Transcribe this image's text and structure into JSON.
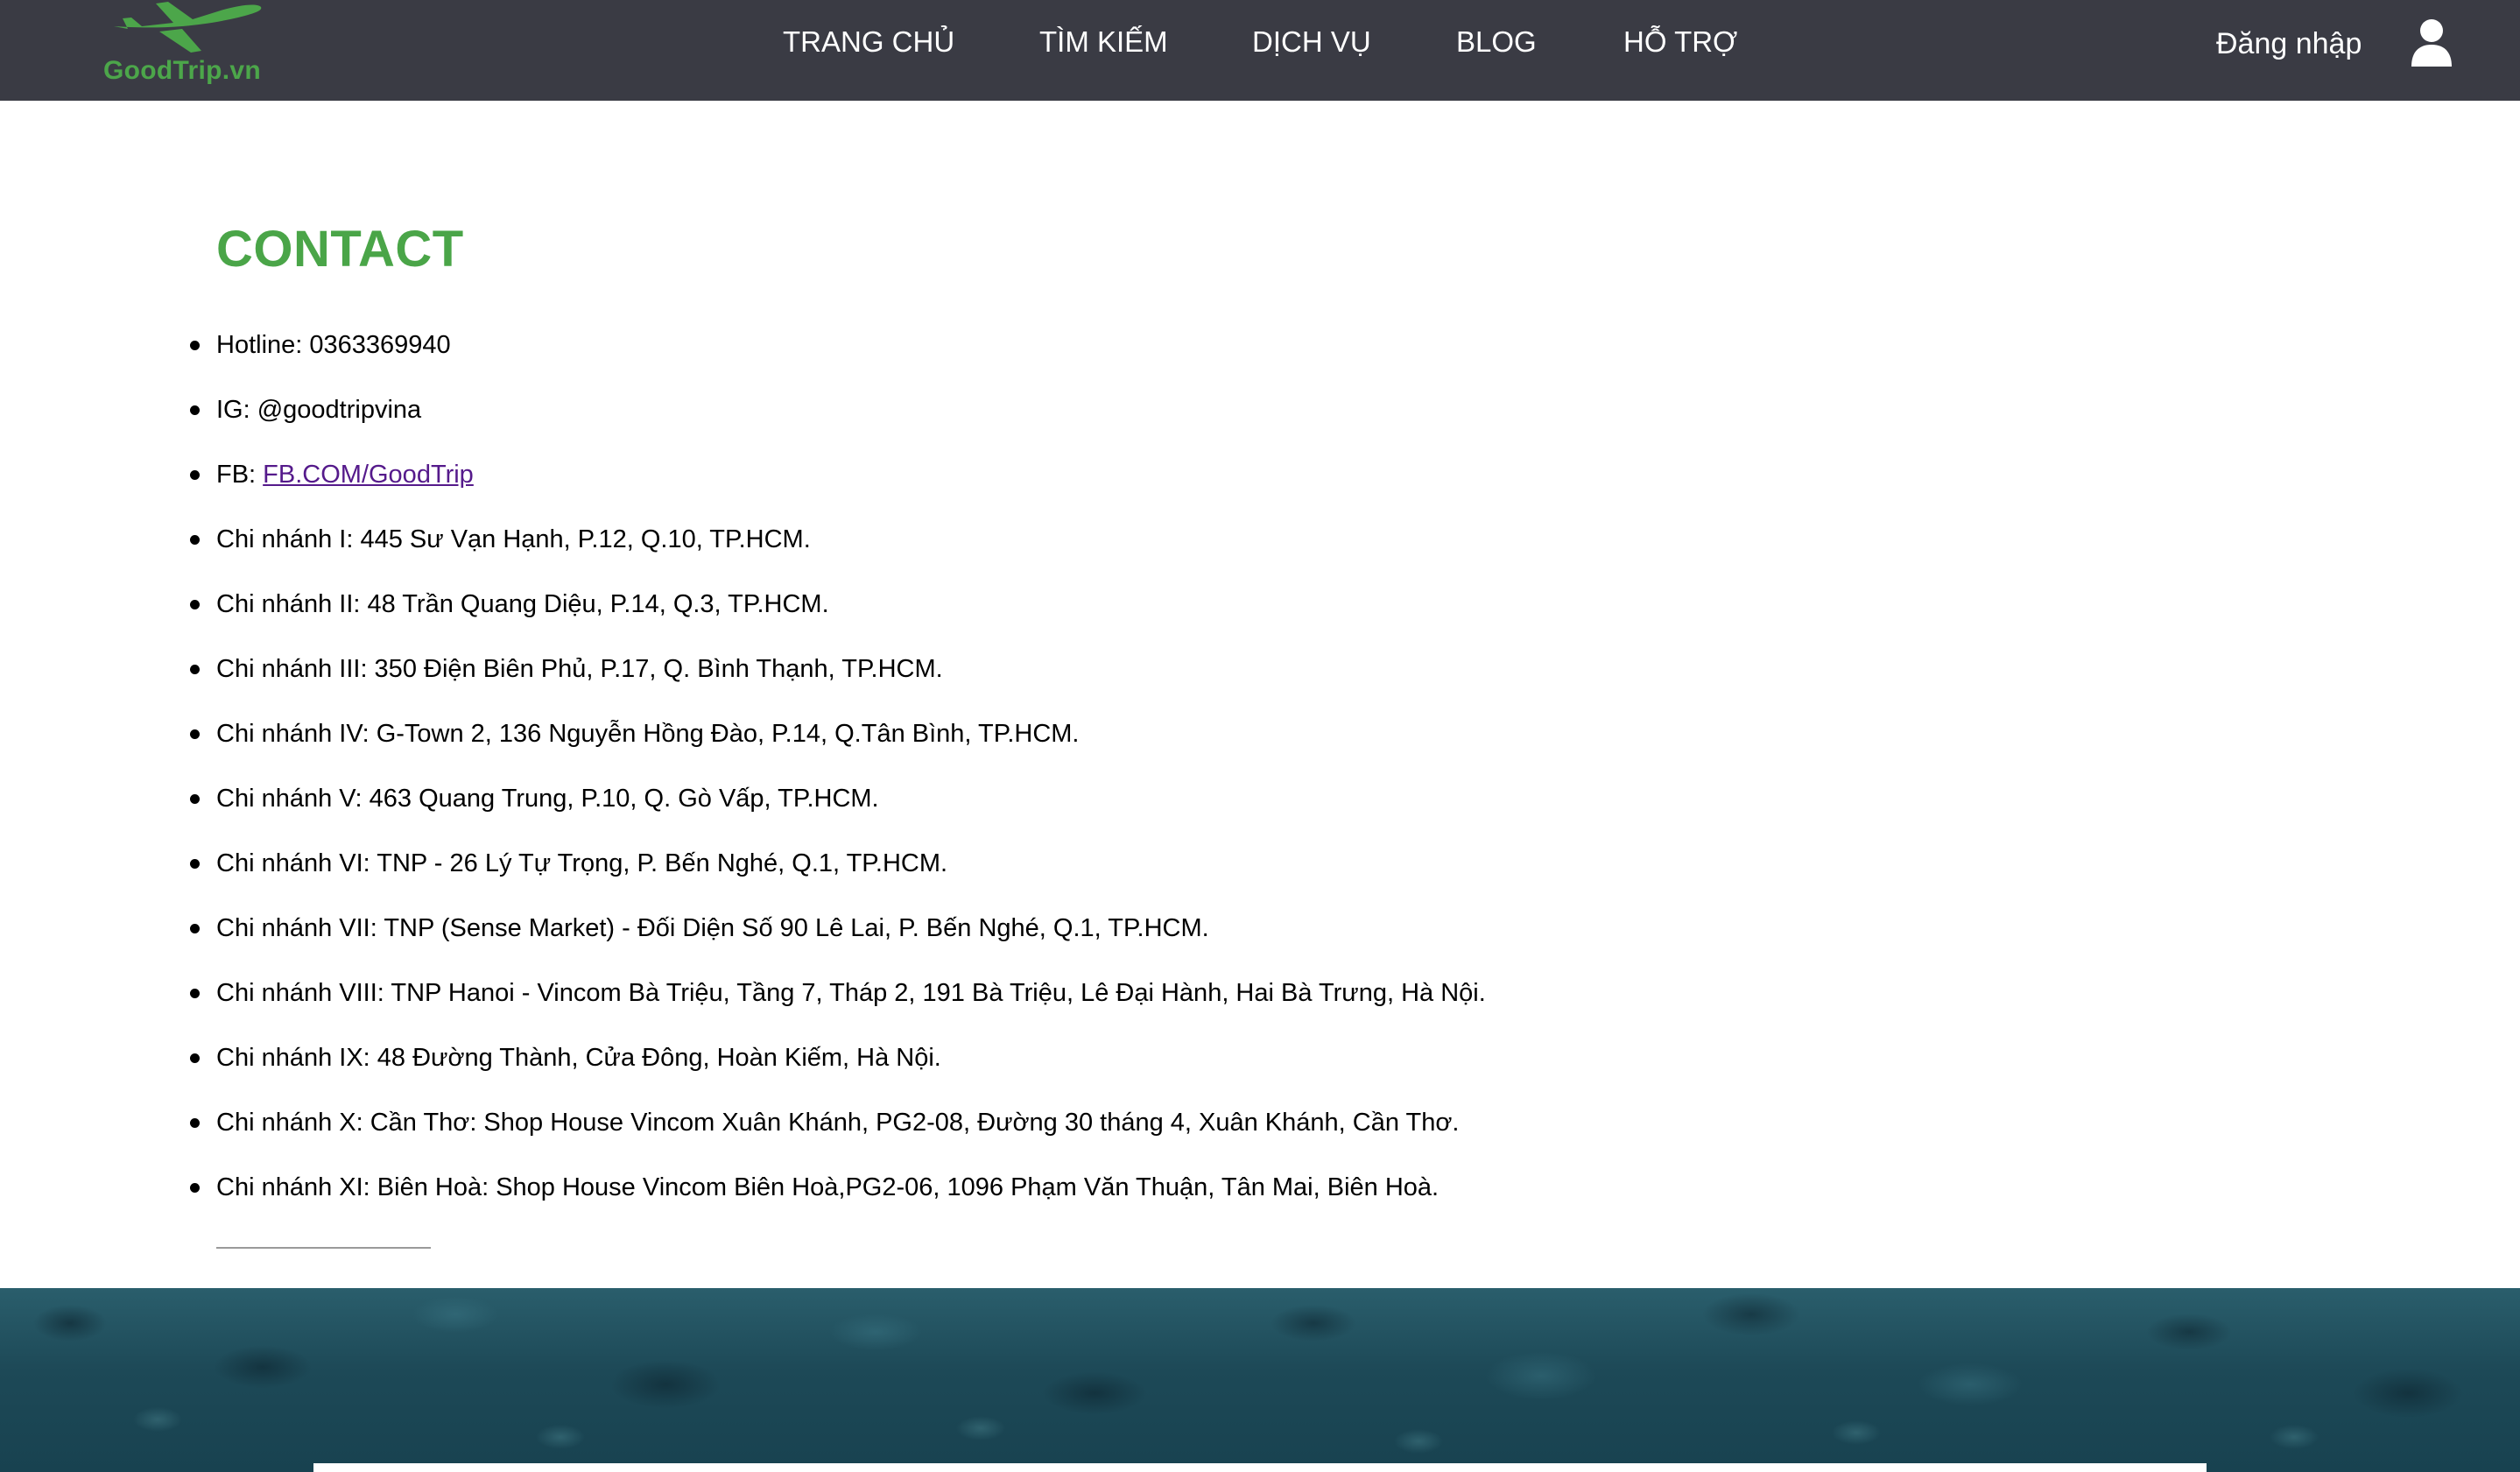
{
  "brand": {
    "name": "GoodTrip.vn",
    "logo_icon": "airplane-icon",
    "logo_color": "#4ca64a"
  },
  "nav": {
    "items": [
      {
        "label": "TRANG CHỦ"
      },
      {
        "label": "TÌM KIẾM"
      },
      {
        "label": "DỊCH VỤ"
      },
      {
        "label": "BLOG"
      },
      {
        "label": "HỖ TRỢ"
      }
    ],
    "login_label": "Đăng nhập",
    "user_icon": "user-icon",
    "background": "#3a3b44"
  },
  "contact": {
    "title": "CONTACT",
    "title_color": "#4aa548",
    "hotline": "Hotline: 0363369940",
    "instagram": "IG: @goodtripvina",
    "facebook_prefix": "FB: ",
    "facebook_link": "FB.COM/GoodTrip",
    "branches": [
      "Chi nhánh I: 445 Sư Vạn Hạnh, P.12, Q.10, TP.HCM.",
      "Chi nhánh II: 48 Trần Quang Diệu, P.14, Q.3, TP.HCM.",
      "Chi nhánh III: 350 Điện Biên Phủ, P.17, Q. Bình Thạnh, TP.HCM.",
      "Chi nhánh IV: G-Town 2, 136 Nguyễn Hồng Đào, P.14, Q.Tân Bình, TP.HCM.",
      "Chi nhánh V: 463 Quang Trung, P.10, Q. Gò Vấp, TP.HCM.",
      "Chi nhánh VI: TNP - 26 Lý Tự Trọng, P. Bến Nghé, Q.1, TP.HCM.",
      "Chi nhánh VII: TNP (Sense Market) - Đối Diện Số 90 Lê Lai, P. Bến Nghé, Q.1, TP.HCM.",
      "Chi nhánh VIII: TNP Hanoi - Vincom Bà Triệu, Tầng 7, Tháp 2, 191 Bà Triệu, Lê Đại Hành, Hai Bà Trưng, Hà Nội.",
      "Chi nhánh IX: 48 Đường Thành, Cửa Đông, Hoàn Kiếm, Hà Nội.",
      "Chi nhánh X: Cần Thơ: Shop House Vincom Xuân Khánh, PG2-08, Đường 30 tháng 4, Xuân Khánh, Cần Thơ.",
      "Chi nhánh XI: Biên Hoà: Shop House Vincom Biên Hoà,PG2-06, 1096 Phạm Văn Thuận, Tân Mai, Biên Hoà."
    ]
  }
}
